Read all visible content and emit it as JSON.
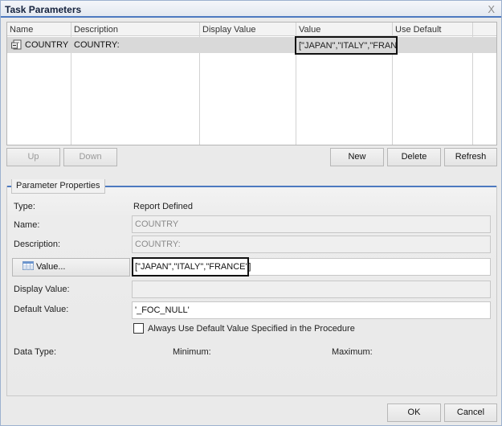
{
  "dialog": {
    "title": "Task Parameters",
    "close_label": "X"
  },
  "grid": {
    "columns": [
      "Name",
      "Description",
      "Display Value",
      "Value",
      "Use Default"
    ],
    "rows": [
      {
        "icon": "parameter-icon",
        "name": "COUNTRY",
        "description": "COUNTRY:",
        "display_value": "",
        "value": "[\"JAPAN\",\"ITALY\",\"FRAN",
        "use_default": ""
      }
    ]
  },
  "grid_buttons": {
    "up": "Up",
    "down": "Down",
    "new": "New",
    "delete": "Delete",
    "refresh": "Refresh"
  },
  "properties": {
    "legend": "Parameter Properties",
    "type_label": "Type:",
    "type_value": "Report Defined",
    "name_label": "Name:",
    "name_value": "COUNTRY",
    "description_label": "Description:",
    "description_value": "COUNTRY:",
    "value_button": "Value...",
    "value_value": "[\"JAPAN\",\"ITALY\",\"FRANCE\"]",
    "display_value_label": "Display Value:",
    "display_value_value": "",
    "default_value_label": "Default Value:",
    "default_value_value": "'_FOC_NULL'",
    "always_default_label": "Always Use Default Value Specified in the Procedure",
    "always_default_checked": false,
    "data_type_label": "Data Type:",
    "minimum_label": "Minimum:",
    "maximum_label": "Maximum:"
  },
  "footer": {
    "ok": "OK",
    "cancel": "Cancel"
  }
}
